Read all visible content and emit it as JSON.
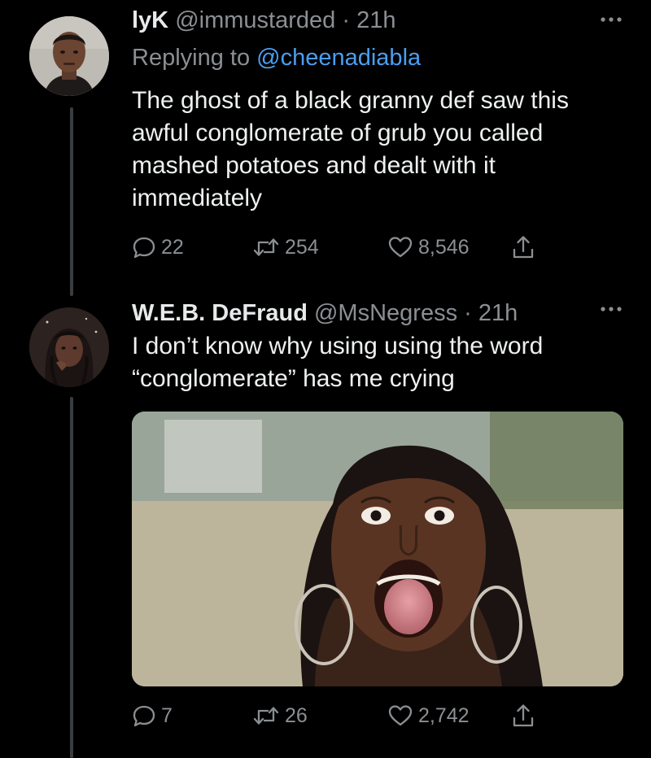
{
  "tweets": [
    {
      "display_name": "lyK",
      "handle": "@immustarded",
      "separator": "·",
      "time": "21h",
      "replying_label": "Replying to",
      "replying_to": "@cheenadiabla",
      "text": "The ghost of a black granny def saw this awful conglomerate of grub you called mashed potatoes and dealt with it immediately",
      "replies": "22",
      "retweets": "254",
      "likes": "8,546"
    },
    {
      "display_name": "W.E.B. DeFraud",
      "handle": "@MsNegress",
      "separator": "·",
      "time": "21h",
      "text": "I don’t know why using using the word “conglomerate” has me crying",
      "replies": "7",
      "retweets": "26",
      "likes": "2,742"
    }
  ],
  "icons": {
    "more": "more-icon",
    "reply": "reply-icon",
    "retweet": "retweet-icon",
    "like": "heart-icon",
    "share": "share-icon"
  },
  "colors": {
    "background": "#000000",
    "text": "#e7e9ea",
    "secondary": "#8b8f93",
    "link": "#4b9ef0",
    "thread_line": "#3a3d40"
  }
}
